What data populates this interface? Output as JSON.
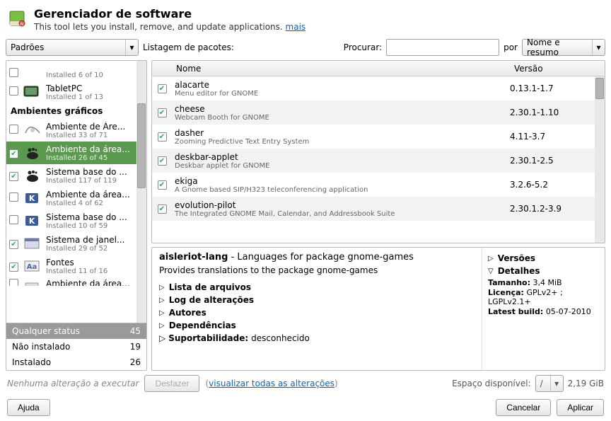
{
  "header": {
    "title": "Gerenciador de software",
    "subtitle": "This tool lets you install, remove, and update applications.",
    "more_link": "mais"
  },
  "topbar": {
    "filter_combo": "Padrões",
    "listing_label": "Listagem de pacotes:",
    "search_label": "Procurar:",
    "search_value": "",
    "by_label": "por",
    "by_combo": "Nome e resumo"
  },
  "sidebar": {
    "items": [
      {
        "checked": false,
        "title": "",
        "sub": "Installed 6 of 10",
        "header": false,
        "partial_top": true
      },
      {
        "checked": false,
        "title": "TabletPC",
        "sub": "Installed 1 of 13",
        "header": false
      },
      {
        "title": "Ambientes gráficos",
        "header": true
      },
      {
        "checked": false,
        "title": "Ambiente de Áre...",
        "sub": "Installed 33 of 71",
        "header": false
      },
      {
        "checked": true,
        "title": "Ambiente da área...",
        "sub": "Installed 26 of 45",
        "header": false,
        "selected": true
      },
      {
        "checked": true,
        "title": "Sistema base do ...",
        "sub": "Installed 117 of 119",
        "header": false
      },
      {
        "checked": false,
        "title": "Ambiente da área...",
        "sub": "Installed 4 of 62",
        "header": false
      },
      {
        "checked": false,
        "title": "Sistema base do ...",
        "sub": "Installed 10 of 59",
        "header": false
      },
      {
        "checked": true,
        "title": "Sistema de janel...",
        "sub": "Installed 29 of 52",
        "header": false
      },
      {
        "checked": true,
        "title": "Fontes",
        "sub": "Installed 11 of 16",
        "header": false
      },
      {
        "checked": false,
        "title": "Ambiente da área...",
        "sub": "",
        "header": false,
        "partial_bottom": true
      }
    ],
    "status": [
      {
        "label": "Qualquer status",
        "count": "45",
        "active": true
      },
      {
        "label": "Não instalado",
        "count": "19",
        "active": false
      },
      {
        "label": "Instalado",
        "count": "26",
        "active": false
      }
    ]
  },
  "packages": {
    "columns": {
      "name": "Nome",
      "version": "Versão"
    },
    "rows": [
      {
        "checked": true,
        "name": "alacarte",
        "desc": "Menu editor for GNOME",
        "version": "0.13.1-1.7"
      },
      {
        "checked": true,
        "name": "cheese",
        "desc": "Webcam Booth for GNOME",
        "version": "2.30.1-1.10"
      },
      {
        "checked": true,
        "name": "dasher",
        "desc": "Zooming Predictive Text Entry System",
        "version": "4.11-3.7"
      },
      {
        "checked": true,
        "name": "deskbar-applet",
        "desc": "Deskbar applet for GNOME",
        "version": "2.30.1-2.5"
      },
      {
        "checked": true,
        "name": "ekiga",
        "desc": "A Gnome based SIP/H323 teleconferencing application",
        "version": "3.2.6-5.2"
      },
      {
        "checked": true,
        "name": "evolution-pilot",
        "desc": "The Integrated GNOME Mail, Calendar, and Addressbook Suite",
        "version": "2.30.1.2-3.9"
      }
    ]
  },
  "details": {
    "title_name": "aisleriot-lang",
    "title_sep": " - ",
    "title_desc": "Languages for package gnome-games",
    "description": "Provides translations to the package gnome-games",
    "expanders": [
      "Lista de arquivos",
      "Log de alterações",
      "Autores",
      "Dependências"
    ],
    "support_label": "Suportabilidade:",
    "support_value": "desconhecido",
    "right": {
      "versions": "Versões",
      "details": "Detalhes",
      "size_label": "Tamanho:",
      "size_value": "3,4 MiB",
      "license_label": "Licença:",
      "license_value": "GPLv2+ ; LGPLv2.1+",
      "build_label": "Latest build:",
      "build_value": "05-07-2010"
    }
  },
  "statusbar": {
    "no_changes": "Nenhuma alteração a executar",
    "undo": "Desfazer",
    "view_all": "visualizar todas as alterações",
    "disk_label": "Espaço disponível:",
    "disk_combo": "/",
    "disk_value": "2,19 GiB"
  },
  "buttons": {
    "help": "Ajuda",
    "cancel": "Cancelar",
    "apply": "Aplicar"
  }
}
